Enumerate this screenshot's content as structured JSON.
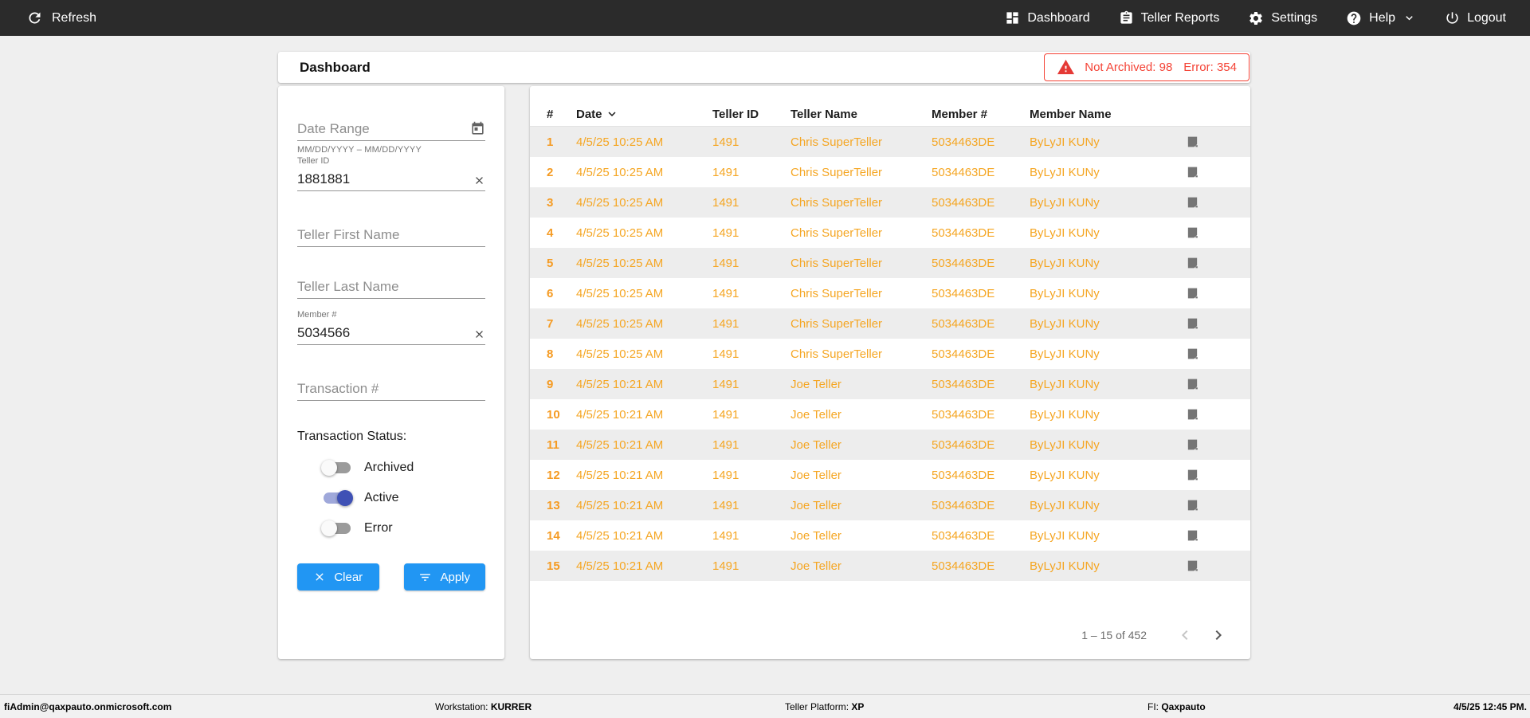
{
  "colors": {
    "topbar_bg": "#2B2B2B",
    "accent_blue": "#2196F3",
    "row_orange": "#F5A623",
    "alert_red": "#F44336",
    "toggle_on": "#3F51B5"
  },
  "topbar": {
    "refresh_label": "Refresh",
    "nav": [
      {
        "label": "Dashboard",
        "icon": "dashboard-icon"
      },
      {
        "label": "Teller Reports",
        "icon": "clipboard-icon"
      },
      {
        "label": "Settings",
        "icon": "gear-icon"
      },
      {
        "label": "Help",
        "icon": "help-icon"
      },
      {
        "label": "Logout",
        "icon": "power-icon"
      }
    ]
  },
  "header": {
    "title": "Dashboard",
    "alert": {
      "not_archived": "Not Archived: 98",
      "error": "Error: 354"
    }
  },
  "filters": {
    "date_range": {
      "placeholder": "Date Range",
      "hint": "MM/DD/YYYY – MM/DD/YYYY"
    },
    "teller_id": {
      "label": "Teller ID",
      "value": "1881881"
    },
    "teller_first_name": {
      "placeholder": "Teller First Name"
    },
    "teller_last_name": {
      "placeholder": "Teller Last Name"
    },
    "member_number": {
      "label": "Member #",
      "value": "5034566"
    },
    "transaction_number": {
      "placeholder": "Transaction #"
    },
    "status_label": "Transaction Status:",
    "status_toggles": [
      {
        "label": "Archived",
        "on": false
      },
      {
        "label": "Active",
        "on": true
      },
      {
        "label": "Error",
        "on": false
      }
    ],
    "clear_label": "Clear",
    "apply_label": "Apply"
  },
  "table": {
    "columns": {
      "num": "#",
      "date": "Date",
      "teller_id": "Teller ID",
      "teller_name": "Teller Name",
      "member_number": "Member #",
      "member_name": "Member Name"
    },
    "sorted_by": "Date",
    "rows": [
      {
        "num": "1",
        "date": "4/5/25 10:25 AM",
        "teller_id": "1491",
        "teller_name": "Chris SuperTeller",
        "member_number": "5034463DE",
        "member_name": "ByLyJI KUNy"
      },
      {
        "num": "2",
        "date": "4/5/25 10:25 AM",
        "teller_id": "1491",
        "teller_name": "Chris SuperTeller",
        "member_number": "5034463DE",
        "member_name": "ByLyJI KUNy"
      },
      {
        "num": "3",
        "date": "4/5/25 10:25 AM",
        "teller_id": "1491",
        "teller_name": "Chris SuperTeller",
        "member_number": "5034463DE",
        "member_name": "ByLyJI KUNy"
      },
      {
        "num": "4",
        "date": "4/5/25 10:25 AM",
        "teller_id": "1491",
        "teller_name": "Chris SuperTeller",
        "member_number": "5034463DE",
        "member_name": "ByLyJI KUNy"
      },
      {
        "num": "5",
        "date": "4/5/25 10:25 AM",
        "teller_id": "1491",
        "teller_name": "Chris SuperTeller",
        "member_number": "5034463DE",
        "member_name": "ByLyJI KUNy"
      },
      {
        "num": "6",
        "date": "4/5/25 10:25 AM",
        "teller_id": "1491",
        "teller_name": "Chris SuperTeller",
        "member_number": "5034463DE",
        "member_name": "ByLyJI KUNy"
      },
      {
        "num": "7",
        "date": "4/5/25 10:25 AM",
        "teller_id": "1491",
        "teller_name": "Chris SuperTeller",
        "member_number": "5034463DE",
        "member_name": "ByLyJI KUNy"
      },
      {
        "num": "8",
        "date": "4/5/25 10:25 AM",
        "teller_id": "1491",
        "teller_name": "Chris SuperTeller",
        "member_number": "5034463DE",
        "member_name": "ByLyJI KUNy"
      },
      {
        "num": "9",
        "date": "4/5/25 10:21 AM",
        "teller_id": "1491",
        "teller_name": "Joe Teller",
        "member_number": "5034463DE",
        "member_name": "ByLyJI KUNy"
      },
      {
        "num": "10",
        "date": "4/5/25 10:21 AM",
        "teller_id": "1491",
        "teller_name": "Joe Teller",
        "member_number": "5034463DE",
        "member_name": "ByLyJI KUNy"
      },
      {
        "num": "11",
        "date": "4/5/25 10:21 AM",
        "teller_id": "1491",
        "teller_name": "Joe Teller",
        "member_number": "5034463DE",
        "member_name": "ByLyJI KUNy"
      },
      {
        "num": "12",
        "date": "4/5/25 10:21 AM",
        "teller_id": "1491",
        "teller_name": "Joe Teller",
        "member_number": "5034463DE",
        "member_name": "ByLyJI KUNy"
      },
      {
        "num": "13",
        "date": "4/5/25 10:21 AM",
        "teller_id": "1491",
        "teller_name": "Joe Teller",
        "member_number": "5034463DE",
        "member_name": "ByLyJI KUNy"
      },
      {
        "num": "14",
        "date": "4/5/25 10:21 AM",
        "teller_id": "1491",
        "teller_name": "Joe Teller",
        "member_number": "5034463DE",
        "member_name": "ByLyJI KUNy"
      },
      {
        "num": "15",
        "date": "4/5/25 10:21 AM",
        "teller_id": "1491",
        "teller_name": "Joe Teller",
        "member_number": "5034463DE",
        "member_name": "ByLyJI KUNy"
      }
    ],
    "pagination": {
      "range": "1 – 15 of 452"
    }
  },
  "footer": {
    "user": "fiAdmin@qaxpauto.onmicrosoft.com",
    "workstation_label": "Workstation:",
    "workstation_value": "KURRER",
    "platform_label": "Teller Platform:",
    "platform_value": "XP",
    "fi_label": "FI:",
    "fi_value": "Qaxpauto",
    "timestamp": "4/5/25 12:45 PM."
  }
}
